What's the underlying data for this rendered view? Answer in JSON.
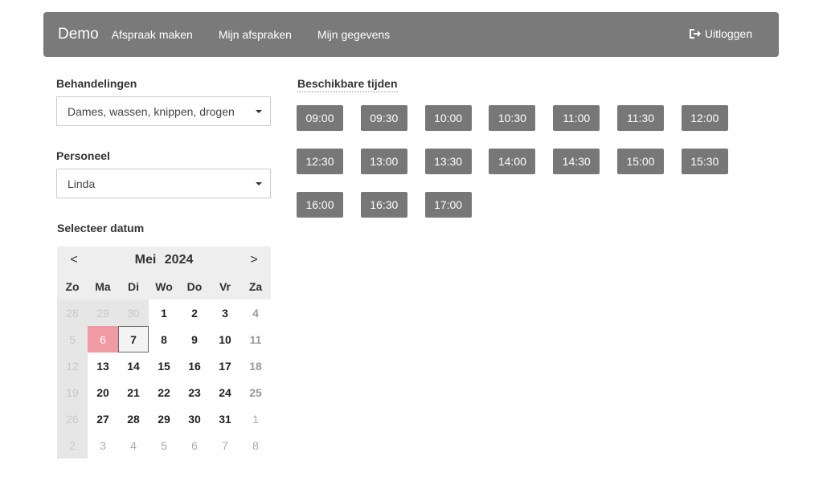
{
  "navbar": {
    "brand": "Demo",
    "links": [
      "Afspraak maken",
      "Mijn afspraken",
      "Mijn gegevens"
    ],
    "logout": "Uitloggen"
  },
  "treatments": {
    "label": "Behandelingen",
    "selected": "Dames, wassen, knippen, drogen"
  },
  "staff": {
    "label": "Personeel",
    "selected": "Linda"
  },
  "date_label": "Selecteer datum",
  "calendar": {
    "prev": "<",
    "next": ">",
    "month": "Mei",
    "year": "2024",
    "weekdays": [
      "Zo",
      "Ma",
      "Di",
      "Wo",
      "Do",
      "Vr",
      "Za"
    ],
    "weeks": [
      [
        "28",
        "29",
        "30",
        "1",
        "2",
        "3",
        "4"
      ],
      [
        "5",
        "6",
        "7",
        "8",
        "9",
        "10",
        "11"
      ],
      [
        "12",
        "13",
        "14",
        "15",
        "16",
        "17",
        "18"
      ],
      [
        "19",
        "20",
        "21",
        "22",
        "23",
        "24",
        "25"
      ],
      [
        "26",
        "27",
        "28",
        "29",
        "30",
        "31",
        "1"
      ],
      [
        "2",
        "3",
        "4",
        "5",
        "6",
        "7",
        "8"
      ]
    ],
    "today": "6",
    "selected": "7"
  },
  "times": {
    "title": "Beschikbare tijden",
    "slots": [
      "09:00",
      "09:30",
      "10:00",
      "10:30",
      "11:00",
      "11:30",
      "12:00",
      "12:30",
      "13:00",
      "13:30",
      "14:00",
      "14:30",
      "15:00",
      "15:30",
      "16:00",
      "16:30",
      "17:00"
    ]
  }
}
